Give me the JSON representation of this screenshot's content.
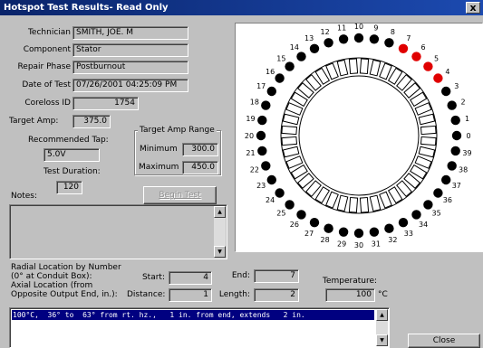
{
  "window": {
    "title": "Hotspot Test Results- Read Only",
    "close_glyph": "x"
  },
  "info": {
    "technician_label": "Technician",
    "technician_value": "SMITH, JOE. M",
    "component_label": "Component",
    "component_value": "Stator",
    "repair_phase_label": "Repair Phase",
    "repair_phase_value": "Postburnout",
    "date_label": "Date of Test",
    "date_value": "07/26/2001 04:25:09 PM",
    "coreloss_label": "Coreloss ID",
    "coreloss_value": "1754",
    "target_amp_label": "Target Amp:",
    "target_amp_value": "375.0",
    "recommended_tap_label": "Recommended Tap:",
    "recommended_tap_value": "5.0V",
    "test_duration_label": "Test Duration:",
    "test_duration_value": "120",
    "notes_label": "Notes:"
  },
  "amp_range": {
    "title": "Target Amp Range",
    "minimum_label": "Minimum",
    "minimum_value": "300.0",
    "maximum_label": "Maximum",
    "maximum_value": "450.0"
  },
  "begin_test_label": "Begin Test",
  "location": {
    "radial_label_line1": "Radial Location by Number",
    "radial_label_line2": "(0° at Conduit Box):",
    "axial_label_line1": "Axial Location (from",
    "axial_label_line2": "Opposite Output End, in.):",
    "start_label": "Start:",
    "start_value": "4",
    "end_label": "End:",
    "end_value": "7",
    "distance_label": "Distance:",
    "distance_value": "1",
    "length_label": "Length:",
    "length_value": "2",
    "temperature_label": "Temperature:",
    "temperature_value": "100",
    "temperature_unit": "°C"
  },
  "results": [
    "100°C,  36° to  63° from rt. hz.,   1 in. from end, extends   2 in."
  ],
  "close_label": "Close",
  "diagram": {
    "slot_numbers": [
      "0",
      "1",
      "2",
      "3",
      "4",
      "5",
      "6",
      "7",
      "8",
      "9",
      "10",
      "11",
      "12",
      "13",
      "14",
      "15",
      "16",
      "17",
      "18",
      "19",
      "20",
      "21",
      "22",
      "23",
      "24",
      "25",
      "26",
      "27",
      "28",
      "29",
      "30",
      "31",
      "32",
      "33",
      "34",
      "35",
      "36",
      "37",
      "38",
      "39"
    ],
    "hotspot_slots": [
      4,
      5,
      6,
      7
    ],
    "colors": {
      "normal": "#000000",
      "hotspot": "#e00000"
    }
  }
}
